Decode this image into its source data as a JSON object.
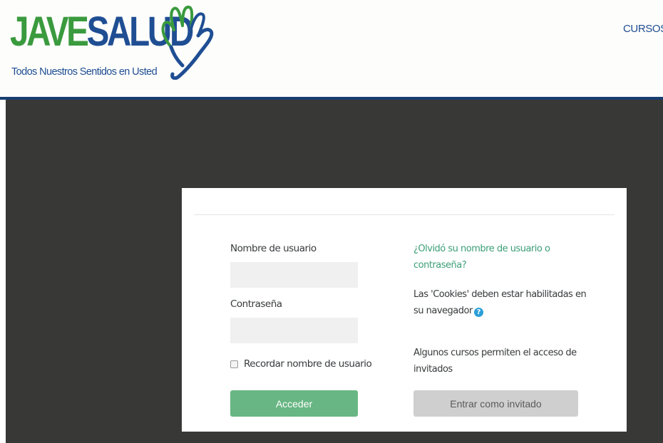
{
  "header": {
    "logo": {
      "word_first": "JAVE",
      "word_second": "SALUD",
      "tagline": "Todos Nuestros Sentidos en Usted",
      "color_green": "#3a9a3e",
      "color_blue": "#1f4e93"
    },
    "nav": {
      "courses_label": "CURSOS",
      "caret_icon": "chevron-down-icon"
    }
  },
  "login": {
    "username": {
      "label": "Nombre de usuario",
      "value": "",
      "placeholder": ""
    },
    "password": {
      "label": "Contraseña",
      "value": "",
      "placeholder": ""
    },
    "remember_label": "Recordar nombre de usuario",
    "remember_checked": false,
    "submit_label": "Acceder",
    "forgot_link": "¿Olvidó su nombre de usuario o contraseña?",
    "cookies_notice": "Las 'Cookies' deben estar habilitadas en su navegador",
    "help_icon": "question-circle-icon",
    "guest_notice": "Algunos cursos permiten el acceso de invitados",
    "guest_button_label": "Entrar como invitado"
  },
  "colors": {
    "accent_green": "#68b683",
    "link_green": "#3c9e77",
    "header_rule": "#173e72",
    "backdrop": "#383836"
  }
}
